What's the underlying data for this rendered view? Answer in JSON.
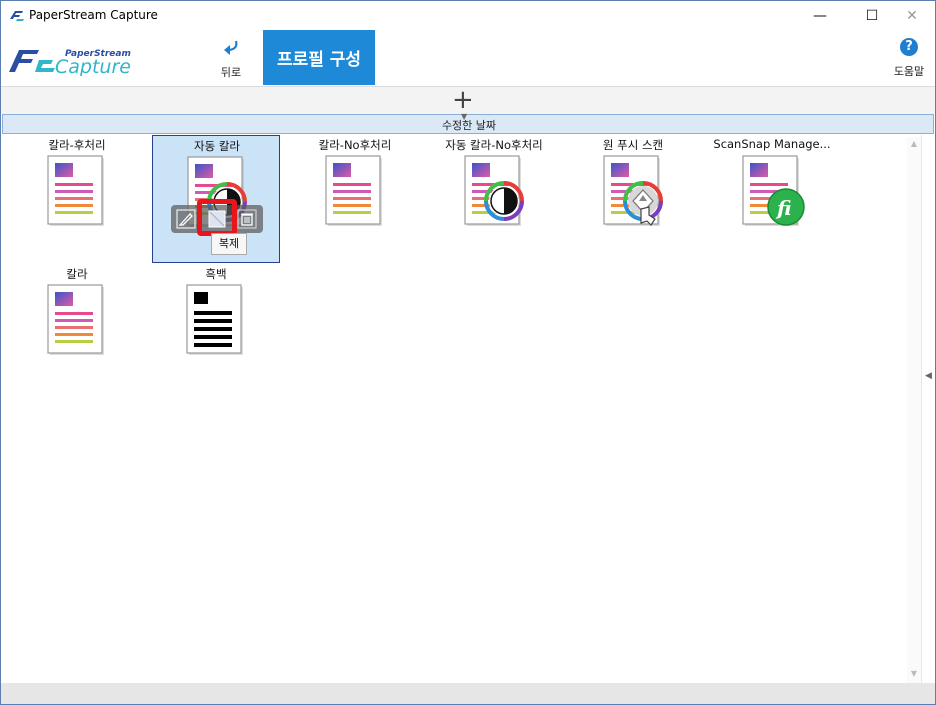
{
  "window": {
    "title": "PaperStream Capture",
    "min_glyph": "—",
    "max_glyph": "☐",
    "close_glyph": "✕"
  },
  "header": {
    "logo_top": "PaperStream",
    "logo_bottom": "Capture",
    "back_label": "뒤로",
    "profile_tab": "프로필 구성",
    "help_label": "도움말",
    "help_glyph": "?"
  },
  "toolbar": {
    "add_glyph": "+",
    "sort_label": "수정한 날짜"
  },
  "tiles": [
    {
      "label": "칼라-후처리",
      "icon": "color-doc-icon"
    },
    {
      "label": "자동 칼라",
      "icon": "auto-color-doc-icon",
      "selected": true
    },
    {
      "label": "칼라-No후처리",
      "icon": "color-doc-icon"
    },
    {
      "label": "자동 칼라-No후처리",
      "icon": "auto-color-doc-icon"
    },
    {
      "label": "원 푸시 스캔",
      "icon": "one-push-scan-icon"
    },
    {
      "label": "ScanSnap Manage...",
      "icon": "scansnap-fi-icon"
    },
    {
      "label": "칼라",
      "icon": "color-doc-icon"
    },
    {
      "label": "흑백",
      "icon": "bw-doc-icon"
    }
  ],
  "hover_actions": {
    "tooltip": "복제"
  },
  "colors": {
    "accent": "#1e89d6",
    "selected_bg": "#cbe3f7",
    "highlight": "#e8161c"
  }
}
